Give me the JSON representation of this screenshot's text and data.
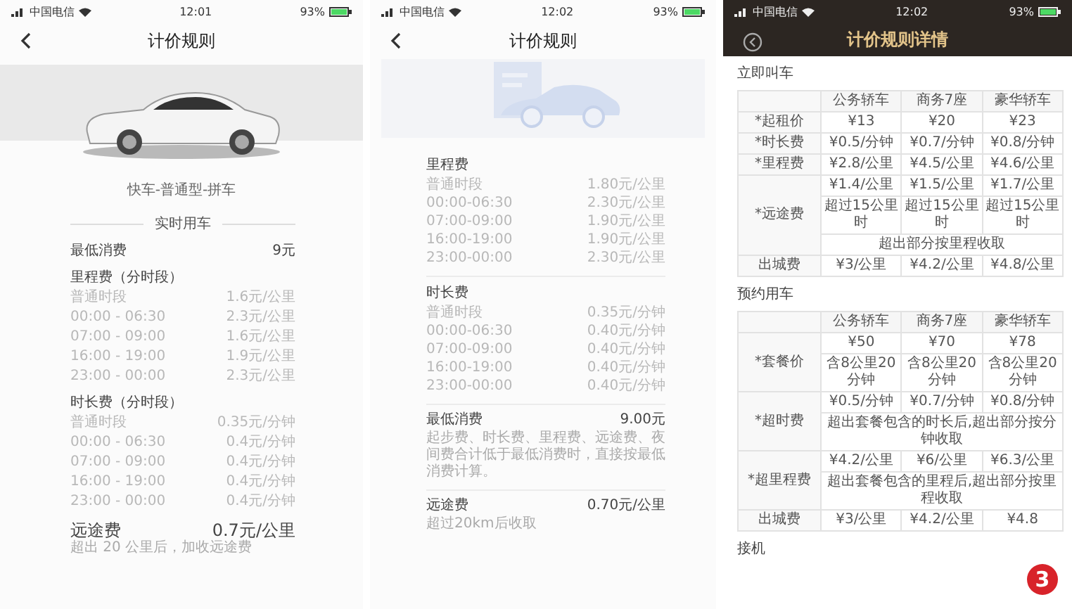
{
  "screen_1": {
    "status_bar": {
      "carrier": "中国电信",
      "time": "12:01",
      "battery": "93%"
    },
    "title": "计价规则",
    "car_type": "快车-普通型-拼车",
    "section_title": "实时用车",
    "min_fee": {
      "label": "最低消费",
      "value": "9元"
    },
    "groups": [
      {
        "title": "里程费（分时段）",
        "rows": [
          {
            "period": "普通时段",
            "price": "1.6元/公里"
          },
          {
            "period": "00:00 - 06:30",
            "price": "2.3元/公里"
          },
          {
            "period": "07:00 - 09:00",
            "price": "1.6元/公里"
          },
          {
            "period": "16:00 - 19:00",
            "price": "1.9元/公里"
          },
          {
            "period": "23:00 - 00:00",
            "price": "2.3元/公里"
          }
        ]
      },
      {
        "title": "时长费（分时段）",
        "rows": [
          {
            "period": "普通时段",
            "price": "0.35元/分钟"
          },
          {
            "period": "00:00 - 06:30",
            "price": "0.4元/分钟"
          },
          {
            "period": "07:00 - 09:00",
            "price": "0.4元/分钟"
          },
          {
            "period": "16:00 - 19:00",
            "price": "0.4元/分钟"
          },
          {
            "period": "23:00 - 00:00",
            "price": "0.4元/分钟"
          }
        ]
      }
    ],
    "far_fee": {
      "label": "远途费",
      "value": "0.7元/公里",
      "note": "超出 20 公里后，加收远途费"
    }
  },
  "screen_2": {
    "status_bar": {
      "carrier": "中国电信",
      "time": "12:02",
      "battery": "93%"
    },
    "title": "计价规则",
    "groups": [
      {
        "title": "里程费",
        "rows": [
          {
            "period": "普通时段",
            "price": "1.80元/公里"
          },
          {
            "period": "00:00-06:30",
            "price": "2.30元/公里"
          },
          {
            "period": "07:00-09:00",
            "price": "1.90元/公里"
          },
          {
            "period": "16:00-19:00",
            "price": "1.90元/公里"
          },
          {
            "period": "23:00-00:00",
            "price": "2.30元/公里"
          }
        ]
      },
      {
        "title": "时长费",
        "rows": [
          {
            "period": "普通时段",
            "price": "0.35元/分钟"
          },
          {
            "period": "00:00-06:30",
            "price": "0.40元/分钟"
          },
          {
            "period": "07:00-09:00",
            "price": "0.40元/分钟"
          },
          {
            "period": "16:00-19:00",
            "price": "0.40元/分钟"
          },
          {
            "period": "23:00-00:00",
            "price": "0.40元/分钟"
          }
        ]
      }
    ],
    "min_fee": {
      "label": "最低消费",
      "value": "9.00元",
      "note": "起步费、时长费、里程费、远途费、夜间费合计低于最低消费时，直接按最低消费计算。"
    },
    "far_fee": {
      "label": "远途费",
      "value": "0.70元/公里",
      "note": "超过20km后收取"
    }
  },
  "screen_3": {
    "status_bar": {
      "carrier": "中国电信",
      "time": "12:02",
      "battery": "93%"
    },
    "title": "计价规则详情",
    "sections": [
      {
        "title": "立即叫车",
        "columns": [
          "公务轿车",
          "商务7座",
          "豪华轿车"
        ],
        "rows": [
          {
            "label": "*起租价",
            "lines": [
              {
                "kind": "cells",
                "cells": [
                  "¥13",
                  "¥20",
                  "¥23"
                ]
              }
            ]
          },
          {
            "label": "*时长费",
            "lines": [
              {
                "kind": "cells",
                "cells": [
                  "¥0.5/分钟",
                  "¥0.7/分钟",
                  "¥0.8/分钟"
                ]
              }
            ]
          },
          {
            "label": "*里程费",
            "lines": [
              {
                "kind": "cells",
                "cells": [
                  "¥2.8/公里",
                  "¥4.5/公里",
                  "¥4.6/公里"
                ]
              }
            ]
          },
          {
            "label": "*远途费",
            "lines": [
              {
                "kind": "cells",
                "cells": [
                  "¥1.4/公里",
                  "¥1.5/公里",
                  "¥1.7/公里"
                ]
              },
              {
                "kind": "cells",
                "cells": [
                  "超过15公里时",
                  "超过15公里时",
                  "超过15公里时"
                ]
              },
              {
                "kind": "note",
                "text": "超出部分按里程收取"
              }
            ]
          },
          {
            "label": "出城费",
            "lines": [
              {
                "kind": "cells",
                "cells": [
                  "¥3/公里",
                  "¥4.2/公里",
                  "¥4.8/公里"
                ]
              }
            ]
          }
        ]
      },
      {
        "title": "预约用车",
        "columns": [
          "公务轿车",
          "商务7座",
          "豪华轿车"
        ],
        "rows": [
          {
            "label": "*套餐价",
            "lines": [
              {
                "kind": "cells",
                "cells": [
                  "¥50",
                  "¥70",
                  "¥78"
                ]
              },
              {
                "kind": "cells",
                "cells": [
                  "含8公里20分钟",
                  "含8公里20分钟",
                  "含8公里20分钟"
                ]
              }
            ]
          },
          {
            "label": "*超时费",
            "lines": [
              {
                "kind": "cells",
                "cells": [
                  "¥0.5/分钟",
                  "¥0.7/分钟",
                  "¥0.8/分钟"
                ]
              },
              {
                "kind": "note",
                "text": "超出套餐包含的时长后,超出部分按分钟收取"
              }
            ]
          },
          {
            "label": "*超里程费",
            "lines": [
              {
                "kind": "cells",
                "cells": [
                  "¥4.2/公里",
                  "¥6/公里",
                  "¥6.3/公里"
                ]
              },
              {
                "kind": "note",
                "text": "超出套餐包含的里程后,超出部分按里程收取"
              }
            ]
          },
          {
            "label": "出城费",
            "lines": [
              {
                "kind": "cells",
                "cells": [
                  "¥3/公里",
                  "¥4.2/公里",
                  "¥4.8"
                ]
              }
            ]
          }
        ]
      },
      {
        "title": "接机"
      }
    ],
    "badge": "3"
  }
}
